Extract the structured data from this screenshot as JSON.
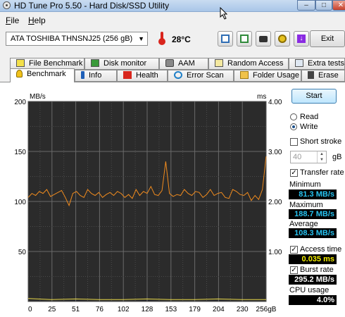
{
  "window": {
    "title": "HD Tune Pro 5.50 - Hard Disk/SSD Utility",
    "min": "–",
    "max": "□",
    "close": "✕"
  },
  "menu": {
    "file": "File",
    "help": "Help"
  },
  "toolbar": {
    "drive": "ATA    TOSHIBA THNSNJ25 (256 gB)",
    "temperature": "28°C",
    "exit_label": "Exit",
    "buttons": [
      "copy-info-icon",
      "copy-text-icon",
      "camera-icon",
      "options-icon",
      "download-icon"
    ]
  },
  "tabs": {
    "row1": [
      "File Benchmark",
      "Disk monitor",
      "AAM",
      "Random Access",
      "Extra tests"
    ],
    "row2": [
      "Benchmark",
      "Info",
      "Health",
      "Error Scan",
      "Folder Usage",
      "Erase"
    ],
    "active": "Benchmark"
  },
  "controls": {
    "start_label": "Start",
    "read_label": "Read",
    "write_label": "Write",
    "mode": "Write",
    "short_stroke_label": "Short stroke",
    "short_stroke_value": "40",
    "short_stroke_unit": "gB",
    "transfer_rate_label": "Transfer rate",
    "minimum_label": "Minimum",
    "minimum_value": "81.3 MB/s",
    "maximum_label": "Maximum",
    "maximum_value": "188.7 MB/s",
    "average_label": "Average",
    "average_value": "108.3 MB/s",
    "access_time_label": "Access time",
    "access_time_value": "0.035 ms",
    "burst_rate_label": "Burst rate",
    "burst_rate_value": "295.2 MB/s",
    "cpu_usage_label": "CPU usage",
    "cpu_usage_value": "4.0%"
  },
  "chart_data": {
    "type": "line",
    "ylabel": "MB/s",
    "y2label": "ms",
    "ylim": [
      0,
      200
    ],
    "y2lim": [
      0,
      4
    ],
    "yticks": [
      "200",
      "150",
      "100",
      "50"
    ],
    "y2ticks": [
      "4.00",
      "3.00",
      "2.00",
      "1.00"
    ],
    "xlim": [
      0,
      256
    ],
    "xticks": [
      "0",
      "25",
      "51",
      "76",
      "102",
      "128",
      "153",
      "179",
      "204",
      "230",
      "256gB"
    ],
    "grid": true,
    "background": "#2b2b2b",
    "series": [
      {
        "color": "#f08b1e",
        "x": [
          0,
          4,
          8,
          12,
          16,
          20,
          24,
          28,
          32,
          36,
          40,
          44,
          48,
          52,
          56,
          60,
          64,
          68,
          72,
          76,
          80,
          84,
          88,
          92,
          96,
          100,
          104,
          108,
          112,
          116,
          120,
          124,
          128,
          132,
          136,
          140,
          144,
          148,
          152,
          156,
          160,
          164,
          168,
          172,
          176,
          180,
          184,
          188,
          192,
          196,
          200,
          204,
          208,
          212,
          216,
          220,
          224,
          228,
          232,
          236,
          240,
          244,
          248,
          252,
          256
        ],
        "values": [
          104,
          108,
          106,
          110,
          108,
          112,
          105,
          107,
          109,
          111,
          104,
          96,
          108,
          110,
          106,
          104,
          112,
          108,
          106,
          109,
          104,
          107,
          109,
          106,
          110,
          108,
          104,
          107,
          103,
          112,
          106,
          110,
          108,
          115,
          107,
          106,
          111,
          140,
          108,
          105,
          107,
          106,
          112,
          108,
          106,
          110,
          109,
          104,
          107,
          112,
          106,
          108,
          109,
          104,
          103,
          112,
          110,
          107,
          106,
          109,
          101,
          106,
          102,
          112,
          145
        ]
      },
      {
        "color": "#e8d84a",
        "x": [
          0,
          25,
          51,
          76,
          102,
          128,
          153,
          179,
          204,
          230,
          256
        ],
        "values": [
          0.06,
          0.04,
          0.05,
          0.04,
          0.04,
          0.05,
          0.04,
          0.04,
          0.05,
          0.04,
          0.04
        ]
      }
    ]
  }
}
